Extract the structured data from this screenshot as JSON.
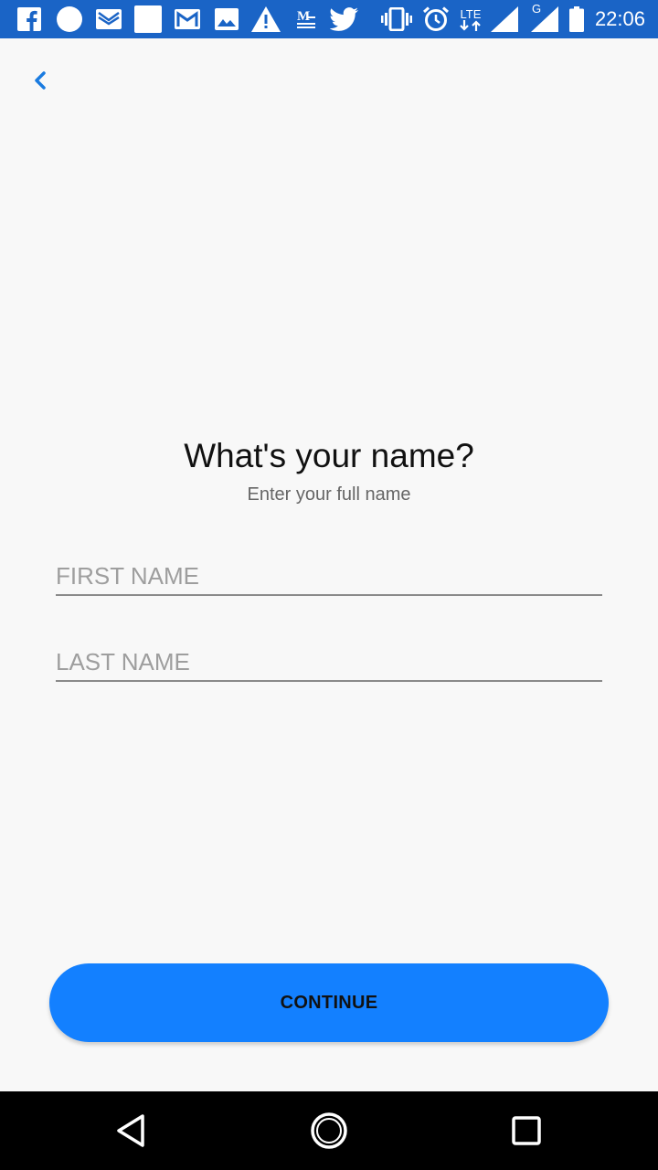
{
  "status_bar": {
    "time": "22:06",
    "network": "LTE",
    "network2": "G",
    "icons": [
      "facebook-icon",
      "circle-icon",
      "mail-icon",
      "blank-icon",
      "gmail-icon",
      "image-icon",
      "warning-icon",
      "news-icon",
      "twitter-icon",
      "vibrate-icon",
      "alarm-icon",
      "lte-icon",
      "signal-icon",
      "signal-g-icon",
      "battery-icon"
    ]
  },
  "header": {
    "back_icon": "chevron-left-icon"
  },
  "main": {
    "title": "What's your name?",
    "subtitle": "Enter your full name",
    "first_name": {
      "placeholder": "FIRST NAME",
      "value": ""
    },
    "last_name": {
      "placeholder": "LAST NAME",
      "value": ""
    },
    "continue_label": "CONTINUE"
  },
  "colors": {
    "status_bar": "#1A64C6",
    "accent": "#1380FF",
    "background": "#F8F8F8",
    "nav_bar": "#000000"
  },
  "nav_bar": {
    "icons": [
      "back-triangle-icon",
      "home-circle-icon",
      "recents-square-icon"
    ]
  }
}
